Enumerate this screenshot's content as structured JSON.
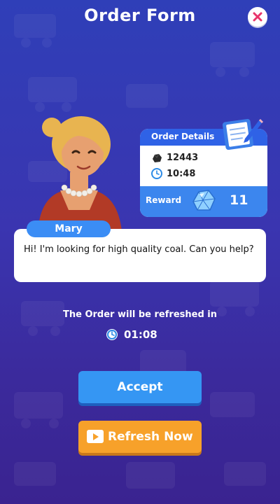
{
  "header": {
    "title": "Order Form"
  },
  "order": {
    "details_title": "Order Details",
    "coal_amount": "12443",
    "time_limit": "10:48",
    "reward_label": "Reward",
    "reward_value": "11"
  },
  "customer": {
    "name": "Mary",
    "message": "Hi! I'm looking for high quality coal. Can you help?"
  },
  "refresh": {
    "label": "The Order will be refreshed in",
    "countdown": "01:08"
  },
  "buttons": {
    "accept": "Accept",
    "refresh_now": "Refresh Now"
  },
  "colors": {
    "accent_blue": "#3596f3",
    "accent_orange": "#f7a12a",
    "close_red": "#e8346a"
  }
}
